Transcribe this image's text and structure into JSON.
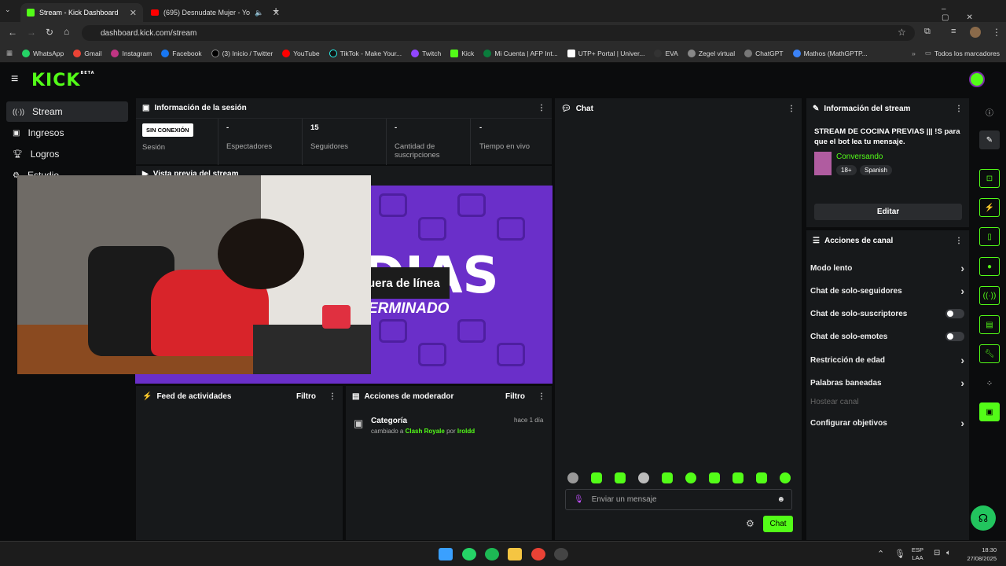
{
  "browser": {
    "tabs": [
      {
        "title": "Stream - Kick Dashboard"
      },
      {
        "title": "(695) Desnudate Mujer - Yo"
      }
    ],
    "url": "dashboard.kick.com/stream",
    "bookmarks": [
      "WhatsApp",
      "Gmail",
      "Instagram",
      "Facebook",
      "(3) Inicio / Twitter",
      "YouTube",
      "TikTok - Make Your...",
      "Twitch",
      "Kick",
      "Mi Cuenta | AFP Int...",
      "UTP+ Portal | Univer...",
      "EVA",
      "Zegel virtual",
      "ChatGPT",
      "Mathos (MathGPTP..."
    ],
    "bookmarks_folder": "Todos los marcadores"
  },
  "app": {
    "logo": "KICK",
    "logo_badge": "BETA"
  },
  "sidebar": {
    "items": [
      {
        "label": "Stream",
        "icon": "broadcast-icon"
      },
      {
        "label": "Ingresos",
        "icon": "revenue-icon"
      },
      {
        "label": "Logros",
        "icon": "trophy-icon"
      },
      {
        "label": "Estudio",
        "icon": "studio-icon"
      }
    ]
  },
  "session": {
    "title": "Información de la sesión",
    "status_badge": "SIN CONEXIÓN",
    "stats": [
      {
        "label": "Sesión",
        "value": ""
      },
      {
        "label": "Espectadores",
        "value": "-"
      },
      {
        "label": "Seguidores",
        "value": "15"
      },
      {
        "label": "Cantidad de suscripciones",
        "value": "-"
      },
      {
        "label": "Tiempo en vivo",
        "value": "-"
      }
    ]
  },
  "preview": {
    "title": "Vista previa del stream",
    "overlay_text": "uera de línea",
    "overlay_sub": "ERMINADO",
    "big_text": "DIAS"
  },
  "feed": {
    "title": "Feed de actividades",
    "filter": "Filtro"
  },
  "mod": {
    "title": "Acciones de moderador",
    "filter": "Filtro",
    "entry": {
      "title": "Categoría",
      "time": "hace 1 día",
      "prefix": "cambiado a",
      "category": "Clash Royale",
      "by": "por",
      "user": "Iroldd"
    }
  },
  "chat": {
    "title": "Chat",
    "placeholder": "Enviar un mensaje",
    "send": "Chat"
  },
  "stream_info": {
    "title": "Información del stream",
    "stream_title": "STREAM DE COCINA PREVIAS ||| !S para que el bot lea tu mensaje.",
    "category": "Conversando",
    "tags": [
      "18+",
      "Spanish"
    ],
    "edit": "Editar"
  },
  "channel_actions": {
    "title": "Acciones de canal",
    "items": [
      {
        "label": "Modo lento",
        "kind": "arrow"
      },
      {
        "label": "Chat de solo-seguidores",
        "kind": "arrow"
      },
      {
        "label": "Chat de solo-suscriptores",
        "kind": "toggle"
      },
      {
        "label": "Chat de solo-emotes",
        "kind": "toggle"
      },
      {
        "label": "Restricción de edad",
        "kind": "arrow"
      },
      {
        "label": "Palabras baneadas",
        "kind": "arrow"
      },
      {
        "label": "Hostear canal",
        "kind": "disabled"
      },
      {
        "label": "Configurar objetivos",
        "kind": "arrow"
      }
    ]
  },
  "taskbar": {
    "lang": "ESP",
    "lang2": "LAA",
    "time": "18:30",
    "date": "27/08/2025"
  },
  "colors": {
    "accent": "#53fc18",
    "panel": "#17191b",
    "bg": "#0b0c0d",
    "purple": "#6a2fc9"
  }
}
